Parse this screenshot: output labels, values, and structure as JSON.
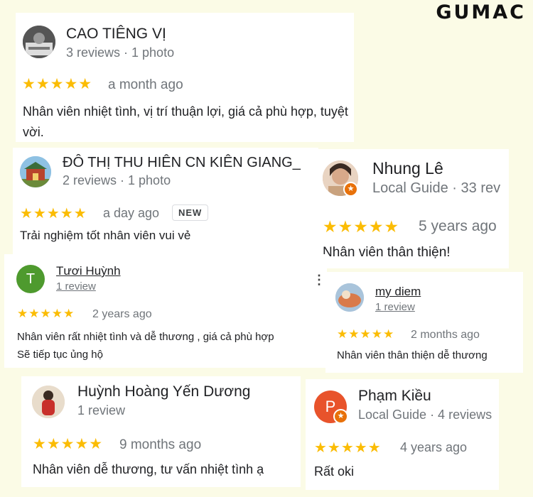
{
  "brand": "GUMAC",
  "reviews": [
    {
      "name": "CAO TIÊNG VỊ",
      "meta": "3 reviews · 1 photo",
      "stars": "★★★★★",
      "ago": "a month ago",
      "text": "Nhân viên nhiệt tình, vị trí thuận lợi, giá cả phù hợp, tuyệt vời."
    },
    {
      "name": "ĐÔ THỊ THU HIÊN CN KIÊN GIANG_",
      "meta": "2 reviews · 1 photo",
      "stars": "★★★★★",
      "ago": "a day ago",
      "badge": "NEW",
      "text": "Trải nghiệm tốt nhân viên vui vẻ"
    },
    {
      "name": "Nhung Lê",
      "meta": "Local Guide · 33 rev",
      "stars": "★★★★★",
      "ago": "5 years ago",
      "text": "Nhân viên thân thiện!"
    },
    {
      "name": "Tươi Huỳnh",
      "meta": "1 review",
      "initial": "T",
      "stars": "★★★★★",
      "ago": "2 years ago",
      "text": "Nhân viên rất nhiệt tình và dễ thương , giá cả phù hợp\nSẽ tiếp tục ủng hộ"
    },
    {
      "name": "my diem",
      "meta": "1 review",
      "stars": "★★★★★",
      "ago": "2 months ago",
      "text": "Nhân viên thân thiện dễ thương"
    },
    {
      "name": "Huỳnh Hoàng Yến Dương",
      "meta": "1 review",
      "stars": "★★★★★",
      "ago": "9 months ago",
      "text": "Nhân viên dễ thương, tư vấn nhiệt tình ạ"
    },
    {
      "name": "Phạm Kiều",
      "meta": "Local Guide · 4 reviews",
      "initial": "P",
      "stars": "★★★★★",
      "ago": "4 years ago",
      "text": "Rất oki"
    }
  ],
  "icons": {
    "more": "more-vert-icon",
    "local_guide": "star-badge-icon"
  },
  "colors": {
    "star": "#fbbc04",
    "avatar_t": "#4e9a2e",
    "avatar_p": "#e8532b",
    "local_guide": "#e8710a"
  }
}
